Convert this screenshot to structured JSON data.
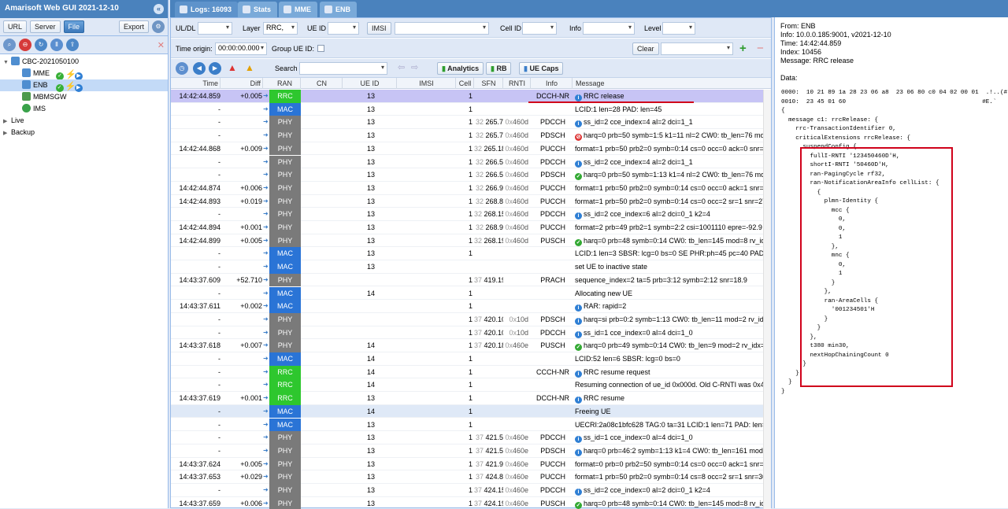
{
  "app": {
    "title": "Amarisoft Web GUI 2021-12-10"
  },
  "left_toolbar": {
    "url": "URL",
    "server": "Server",
    "file": "File",
    "export": "Export"
  },
  "tree": {
    "root": "CBC-2021050100",
    "mme": "MME",
    "enb": "ENB",
    "mbmsgw": "MBMSGW",
    "ims": "IMS",
    "live": "Live",
    "backup": "Backup"
  },
  "tabs": [
    {
      "label": "Logs: 16093"
    },
    {
      "label": "Stats"
    },
    {
      "label": "MME"
    },
    {
      "label": "ENB"
    }
  ],
  "filters": {
    "uldl": "UL/DL",
    "layer_label": "Layer",
    "layer_value": "RRC,",
    "ueid_label": "UE ID",
    "imsi_btn": "IMSI",
    "cellid_label": "Cell ID",
    "info_label": "Info",
    "level_label": "Level",
    "time_origin_label": "Time origin:",
    "time_origin_value": "00:00:00.000",
    "group_ueid_label": "Group UE ID:",
    "clear": "Clear",
    "search_label": "Search",
    "analytics": "Analytics",
    "rb": "RB",
    "uecaps": "UE Caps"
  },
  "columns": {
    "time": "Time",
    "diff": "Diff",
    "ran": "RAN",
    "cn": "CN",
    "ueid": "UE ID",
    "imsi": "IMSI",
    "cell": "Cell",
    "sfn": "SFN",
    "rnti": "RNTI",
    "info": "Info",
    "message": "Message"
  },
  "colors": {
    "RRC": "#2ec72e",
    "MAC": "#2a74d6",
    "PHY": "#7a7a7a"
  },
  "rows": [
    {
      "cells": [
        "14:42:44.859",
        "+0.005",
        "RRC",
        "13",
        "1",
        "",
        "",
        "",
        "DCCH-NR",
        "RRC release"
      ],
      "sel": true,
      "icon": "info"
    },
    {
      "cells": [
        "-",
        "",
        "MAC",
        "13",
        "1",
        "",
        "",
        "",
        "",
        "LCID:1 len=28 PAD: len=45"
      ]
    },
    {
      "cells": [
        "-",
        "",
        "PHY",
        "13",
        "1",
        "32",
        "265.7",
        "0x460d",
        "PDCCH",
        "ss_id=2 cce_index=4 al=2 dci=1_1"
      ],
      "icon": "info"
    },
    {
      "cells": [
        "-",
        "",
        "PHY",
        "13",
        "1",
        "32",
        "265.7",
        "0x460d",
        "PDSCH",
        "harq=0 prb=50 symb=1:5 k1=11 nl=2 CW0: tb_len=76 mo"
      ],
      "icon": "stop"
    },
    {
      "cells": [
        "14:42:44.868",
        "+0.009",
        "PHY",
        "13",
        "1",
        "32",
        "265.18",
        "0x460d",
        "PUCCH",
        "format=1 prb=50 prb2=0 symb=0:14 cs=0 occ=0 ack=0 snr=27"
      ]
    },
    {
      "cells": [
        "-",
        "",
        "PHY",
        "13",
        "1",
        "32",
        "266.5",
        "0x460d",
        "PDCCH",
        "ss_id=2 cce_index=4 al=2 dci=1_1"
      ],
      "icon": "info"
    },
    {
      "cells": [
        "-",
        "",
        "PHY",
        "13",
        "1",
        "32",
        "266.5",
        "0x460d",
        "PDSCH",
        "harq=0 prb=50 symb=1:13 k1=4 nl=2 CW0: tb_len=76 mo"
      ],
      "icon": "ok"
    },
    {
      "cells": [
        "14:42:44.874",
        "+0.006",
        "PHY",
        "13",
        "1",
        "32",
        "266.9",
        "0x460d",
        "PUCCH",
        "format=1 prb=50 prb2=0 symb=0:14 cs=0 occ=0 ack=1 snr=26"
      ]
    },
    {
      "cells": [
        "14:42:44.893",
        "+0.019",
        "PHY",
        "13",
        "1",
        "32",
        "268.8",
        "0x460d",
        "PUCCH",
        "format=1 prb=50 prb2=0 symb=0:14 cs=0 occ=2 sr=1 snr=27.7"
      ]
    },
    {
      "cells": [
        "-",
        "",
        "PHY",
        "13",
        "1",
        "32",
        "268.15",
        "0x460d",
        "PDCCH",
        "ss_id=2 cce_index=6 al=2 dci=0_1 k2=4"
      ],
      "icon": "info"
    },
    {
      "cells": [
        "14:42:44.894",
        "+0.001",
        "PHY",
        "13",
        "1",
        "32",
        "268.9",
        "0x460d",
        "PUCCH",
        "format=2 prb=49 prb2=1 symb=2:2 csi=1001110 epre=-92.9"
      ]
    },
    {
      "cells": [
        "14:42:44.899",
        "+0.005",
        "PHY",
        "13",
        "1",
        "32",
        "268.19",
        "0x460d",
        "PUSCH",
        "harq=0 prb=48 symb=0:14 CW0: tb_len=145 mod=8 rv_id"
      ],
      "icon": "ok"
    },
    {
      "cells": [
        "-",
        "",
        "MAC",
        "13",
        "1",
        "",
        "",
        "",
        "",
        "LCID:1 len=3 SBSR: lcg=0 bs=0 SE PHR:ph=45 pc=40 PAD: le"
      ]
    },
    {
      "cells": [
        "-",
        "",
        "MAC",
        "13",
        "",
        "",
        "",
        "",
        "",
        "set UE to inactive state"
      ]
    },
    {
      "cells": [
        "14:43:37.609",
        "+52.710",
        "PHY",
        "",
        "1",
        "37",
        "419.19",
        "",
        "PRACH",
        "sequence_index=2 ta=5 prb=3:12 symb=2:12 snr=18.9"
      ]
    },
    {
      "cells": [
        "-",
        "",
        "MAC",
        "14",
        "1",
        "",
        "",
        "",
        "",
        "Allocating new UE"
      ]
    },
    {
      "cells": [
        "14:43:37.611",
        "+0.002",
        "MAC",
        "",
        "1",
        "",
        "",
        "",
        "",
        "RAR: rapid=2"
      ],
      "icon": "info"
    },
    {
      "cells": [
        "-",
        "",
        "PHY",
        "",
        "1",
        "37",
        "420.10",
        "0x10d",
        "PDSCH",
        "harq=si prb=0:2 symb=1:13 CW0: tb_len=11 mod=2 rv_idx="
      ],
      "icon": "info"
    },
    {
      "cells": [
        "-",
        "",
        "PHY",
        "",
        "1",
        "37",
        "420.10",
        "0x10d",
        "PDCCH",
        "ss_id=1 cce_index=0 al=4 dci=1_0"
      ],
      "icon": "info"
    },
    {
      "cells": [
        "14:43:37.618",
        "+0.007",
        "PHY",
        "14",
        "1",
        "37",
        "420.18",
        "0x460e",
        "PUSCH",
        "harq=0 prb=49 symb=0:14 CW0: tb_len=9 mod=2 rv_idx="
      ],
      "icon": "ok"
    },
    {
      "cells": [
        "-",
        "",
        "MAC",
        "14",
        "1",
        "",
        "",
        "",
        "",
        "LCID:52 len=6 SBSR: lcg=0 bs=0"
      ]
    },
    {
      "cells": [
        "-",
        "",
        "RRC",
        "14",
        "1",
        "",
        "",
        "",
        "CCCH-NR",
        "RRC resume request"
      ],
      "icon": "info"
    },
    {
      "cells": [
        "-",
        "",
        "RRC",
        "14",
        "1",
        "",
        "",
        "",
        "",
        "Resuming connection of ue_id 0x000d. Old C-RNTI was 0x460"
      ]
    },
    {
      "cells": [
        "14:43:37.619",
        "+0.001",
        "RRC",
        "13",
        "1",
        "",
        "",
        "",
        "DCCH-NR",
        "RRC resume"
      ],
      "icon": "info"
    },
    {
      "cells": [
        "-",
        "",
        "MAC",
        "14",
        "1",
        "",
        "",
        "",
        "",
        "Freeing UE"
      ],
      "hl": true
    },
    {
      "cells": [
        "-",
        "",
        "MAC",
        "13",
        "1",
        "",
        "",
        "",
        "",
        "UECRI:2a08c1bfc628 TAG:0 ta=31 LCID:1 len=71 PAD: len=7"
      ]
    },
    {
      "cells": [
        "-",
        "",
        "PHY",
        "13",
        "1",
        "37",
        "421.5",
        "0x460e",
        "PDCCH",
        "ss_id=1 cce_index=0 al=4 dci=1_0"
      ],
      "icon": "info"
    },
    {
      "cells": [
        "-",
        "",
        "PHY",
        "13",
        "1",
        "37",
        "421.5",
        "0x460e",
        "PDSCH",
        "harq=0 prb=46:2 symb=1:13 k1=4 CW0: tb_len=161 mod"
      ],
      "icon": "info"
    },
    {
      "cells": [
        "14:43:37.624",
        "+0.005",
        "PHY",
        "13",
        "1",
        "37",
        "421.9",
        "0x460e",
        "PUCCH",
        "format=0 prb=0 prb2=50 symb=0:14 cs=0 occ=0 ack=1 snr=29"
      ]
    },
    {
      "cells": [
        "14:43:37.653",
        "+0.029",
        "PHY",
        "13",
        "1",
        "37",
        "424.8",
        "0x460e",
        "PUCCH",
        "format=1 prb=50 prb2=0 symb=0:14 cs=8 occ=2 sr=1 snr=30.1"
      ]
    },
    {
      "cells": [
        "-",
        "",
        "PHY",
        "13",
        "1",
        "37",
        "424.15",
        "0x460e",
        "PDCCH",
        "ss_id=2 cce_index=0 al=2 dci=0_1 k2=4"
      ],
      "icon": "info"
    },
    {
      "cells": [
        "14:43:37.659",
        "+0.006",
        "PHY",
        "13",
        "1",
        "37",
        "424.19",
        "0x460e",
        "PUSCH",
        "harq=0 prb=48 symb=0:14 CW0: tb_len=145 mod=8 rv_id"
      ],
      "icon": "ok"
    }
  ],
  "detail": {
    "from": "From: ENB",
    "info": "Info: 10.0.0.185:9001, v2021-12-10",
    "time": "Time: 14:42:44.859",
    "index": "Index: 10456",
    "message": "Message: RRC release",
    "data_label": "Data:",
    "body": "0000:  10 21 89 1a 28 23 06 a8  23 06 80 c0 04 02 00 01  .!..(#..#.......\n0010:  23 45 01 60                                      #E.`\n{\n  message c1: rrcRelease: {\n    rrc-TransactionIdentifier 0,\n    criticalExtensions rrcRelease: {\n      suspendConfig {\n        fullI-RNTI '123450460D'H,\n        shortI-RNTI '50460D'H,\n        ran-PagingCycle rf32,\n        ran-NotificationAreaInfo cellList: {\n          {\n            plmn-Identity {\n              mcc {\n                0,\n                0,\n                1\n              },\n              mnc {\n                0,\n                1\n              }\n            },\n            ran-AreaCells {\n              '001234501'H\n            }\n          }\n        },\n        t380 min30,\n        nextHopChainingCount 0\n      }\n    }\n  }\n}"
  }
}
